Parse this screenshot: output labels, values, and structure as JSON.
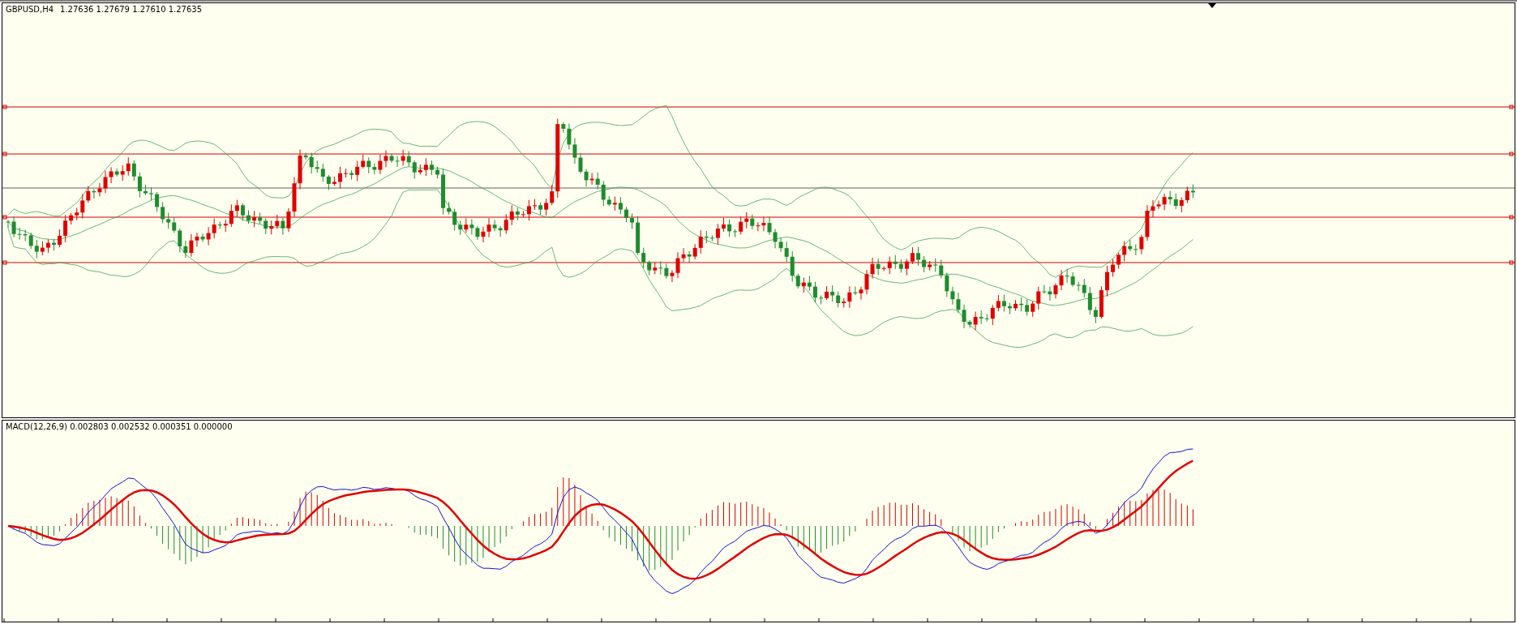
{
  "price_chart": {
    "symbol": "GBPUSD,H4",
    "quotes": "1.27636 1.27679 1.27610 1.27635"
  },
  "macd_panel": {
    "label": "MACD(12,26,9) 0.002803 0.002532 0.000351 0.000000"
  }
}
